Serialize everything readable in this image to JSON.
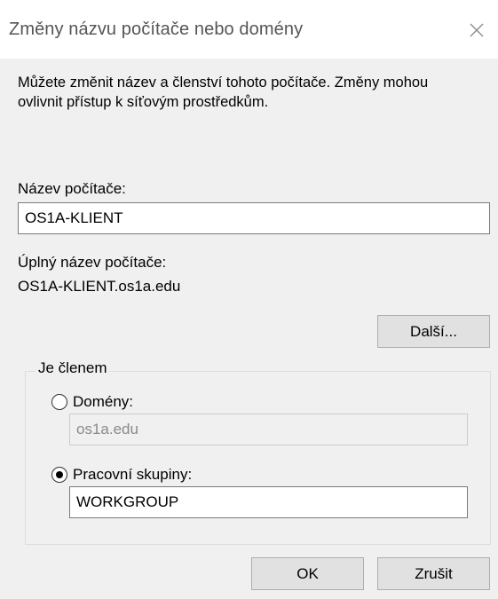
{
  "dialog": {
    "title": "Změny názvu počítače nebo domény",
    "intro": "Můžete změnit název a členství tohoto počítače. Změny mohou ovlivnit přístup k síťovým prostředkům.",
    "computer_name_label": "Název počítače:",
    "computer_name_value": "OS1A-KLIENT",
    "full_name_label": "Úplný název počítače:",
    "full_name_value": "OS1A-KLIENT.os1a.edu",
    "more_button": "Další...",
    "member_of": {
      "legend": "Je členem",
      "domain_label": "Domény:",
      "domain_value": "os1a.edu",
      "domain_selected": false,
      "workgroup_label": "Pracovní skupiny:",
      "workgroup_value": "WORKGROUP",
      "workgroup_selected": true
    },
    "ok_button": "OK",
    "cancel_button": "Zrušit"
  }
}
